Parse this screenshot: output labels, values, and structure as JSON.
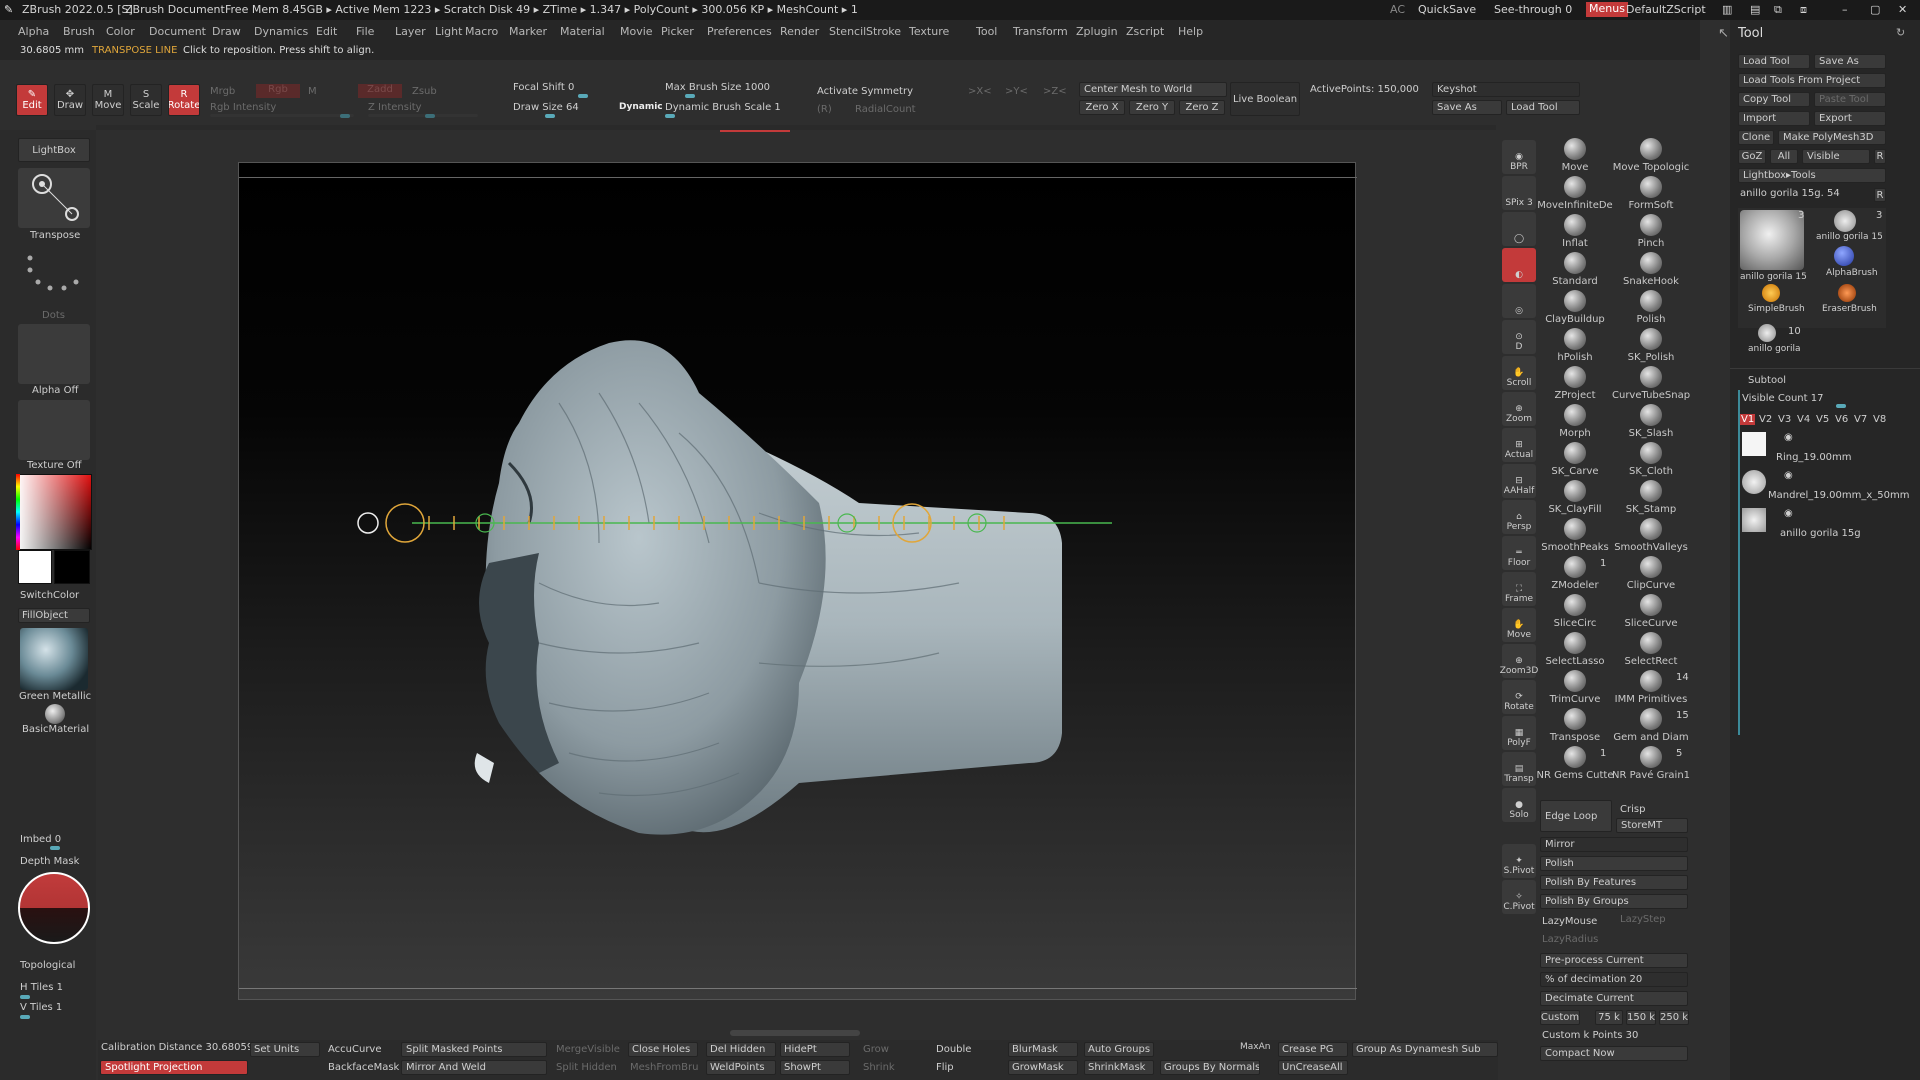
{
  "titlebar": {
    "app": "ZBrush 2022.0.5 [S]",
    "doc": "ZBrush Document",
    "stats": "Free Mem 8.45GB ▸ Active Mem 1223 ▸ Scratch Disk 49 ▸ ZTime ▸ 1.347 ▸ PolyCount ▸ 300.056 KP ▸ MeshCount ▸ 1",
    "ac": "AC",
    "quicksave": "QuickSave",
    "seethrough": "See-through  0",
    "menus": "Menus",
    "script": "DefaultZScript"
  },
  "menu": [
    "Alpha",
    "Brush",
    "Color",
    "Document",
    "Draw",
    "Dynamics",
    "Edit",
    "File",
    "Layer",
    "Light",
    "Macro",
    "Marker",
    "Material",
    "Movie",
    "Picker",
    "Preferences",
    "Render",
    "Stencil",
    "Stroke",
    "Texture",
    "Tool",
    "Transform",
    "Zplugin",
    "Zscript",
    "Help"
  ],
  "infobar": {
    "distance": "30.6805 mm",
    "mode": "TRANSPOSE LINE",
    "hint": "Click to reposition. Press shift to align."
  },
  "shelf": {
    "edit": "Edit",
    "draw": "Draw",
    "move": "Move",
    "scale": "Scale",
    "rotate": "Rotate",
    "mrgb": "Mrgb",
    "rgb": "Rgb",
    "m": "M",
    "zadd": "Zadd",
    "zsub": "Zsub",
    "rgb_intensity": "Rgb Intensity",
    "z_intensity": "Z Intensity",
    "focal_shift": "Focal Shift 0",
    "draw_size": "Draw Size 64",
    "dynamic": "Dynamic",
    "max_brush": "Max Brush Size 1000",
    "dyn_scale": "Dynamic Brush Scale 1",
    "activate_symmetry": "Activate Symmetry",
    "sx": ">X<",
    "sy": ">Y<",
    "sz": ">Z<",
    "r": "(R)",
    "radial": "RadialCount",
    "center_mesh": "Center Mesh to World",
    "zero_x": "Zero X",
    "zero_y": "Zero Y",
    "zero_z": "Zero Z",
    "live_boolean": "Live Boolean",
    "active_points": "ActivePoints: 150,000",
    "keyshot": "Keyshot",
    "save_as": "Save As",
    "load_tool": "Load Tool"
  },
  "left": {
    "lightbox": "LightBox",
    "transpose": "Transpose",
    "dots": "Dots",
    "alpha_off": "Alpha Off",
    "texture_off": "Texture Off",
    "switch_color": "SwitchColor",
    "fill_object": "FillObject",
    "material": "Green Metallic",
    "basic": "BasicMaterial",
    "imbed": "Imbed 0",
    "depth_mask": "Depth Mask",
    "topological": "Topological",
    "htiles": "H Tiles 1",
    "vtiles": "V Tiles 1"
  },
  "nav": [
    "BPR",
    "SPix 3",
    "",
    "",
    "",
    "D",
    "Scroll",
    "Zoom",
    "Actual",
    "AAHalf",
    "Persp",
    "Floor",
    "Frame",
    "Move",
    "Zoom3D",
    "Rotate",
    "PolyF",
    "Transp",
    "Solo",
    "S.Pivot",
    "C.Pivot"
  ],
  "brushes": [
    [
      "Move",
      "Move Topologic"
    ],
    [
      "MoveInfiniteDe",
      "FormSoft"
    ],
    [
      "Inflat",
      "Pinch"
    ],
    [
      "Standard",
      "SnakeHook"
    ],
    [
      "ClayBuildup",
      "Polish"
    ],
    [
      "hPolish",
      "SK_Polish"
    ],
    [
      "ZProject",
      "CurveTubeSnap"
    ],
    [
      "Morph",
      "SK_Slash"
    ],
    [
      "SK_Carve",
      "SK_Cloth"
    ],
    [
      "SK_ClayFill",
      "SK_Stamp"
    ],
    [
      "SmoothPeaks",
      "SmoothValleys"
    ],
    [
      "ZModeler",
      "ClipCurve"
    ],
    [
      "SliceCirc",
      "SliceCurve"
    ],
    [
      "SelectLasso",
      "SelectRect"
    ],
    [
      "TrimCurve",
      "IMM Primitives"
    ],
    [
      "Transpose",
      "Gem and Diam"
    ],
    [
      "NR Gems Cutte",
      "NR Pavé Grain1"
    ]
  ],
  "brush_counts": {
    "imm": "14",
    "gem": "15",
    "nrg": "1",
    "nrp": "5",
    "zm": "1"
  },
  "options": {
    "edge_loop": "Edge Loop",
    "crisp": "Crisp",
    "storemt": "StoreMT",
    "mirror": "Mirror",
    "polish": "Polish",
    "polish_features": "Polish By Features",
    "polish_groups": "Polish By Groups",
    "lazymouse": "LazyMouse",
    "lazystep": "LazyStep",
    "lazyradius": "LazyRadius",
    "preprocess": "Pre-process Current",
    "decimation": "% of decimation 20",
    "decimate": "Decimate Current",
    "custom": "Custom",
    "k75": "75 k",
    "k150": "150 k",
    "k250": "250 k",
    "customk": "Custom k Points 30",
    "compact": "Compact Now"
  },
  "tool": {
    "title": "Tool",
    "load_tool": "Load Tool",
    "save_as": "Save As",
    "load_from_project": "Load Tools From Project",
    "copy_tool": "Copy Tool",
    "paste_tool": "Paste Tool",
    "import": "Import",
    "export": "Export",
    "clone": "Clone",
    "make_polymesh": "Make PolyMesh3D",
    "goz": "GoZ",
    "all": "All",
    "visible": "Visible",
    "r": "R",
    "lightbox_tools": "Lightbox▸Tools",
    "current": "anillo gorila 15g. 54",
    "cur_r": "R",
    "thumbs": [
      "anillo gorila 15",
      "anillo gorila 15",
      "AlphaBrush",
      "SimpleBrush",
      "EraserBrush",
      "anillo gorila"
    ],
    "thumb_counts": [
      "3",
      "3",
      "10"
    ],
    "subtool": "Subtool",
    "visible_count": "Visible Count 17",
    "versions": [
      "V1",
      "V2",
      "V3",
      "V4",
      "V5",
      "V6",
      "V7",
      "V8"
    ],
    "subtools": [
      "Ring_19.00mm",
      "Mandrel_19.00mm_x_50mm",
      "anillo gorila 15g"
    ]
  },
  "bottom": {
    "calibration": "Calibration Distance 30.68059",
    "set_units": "Set Units",
    "spotlight": "Spotlight Projection",
    "accucurve": "AccuCurve",
    "backfacemask": "BackfaceMask",
    "split_masked": "Split Masked Points",
    "mirror_weld": "Mirror And Weld",
    "merge_visible": "MergeVisible",
    "split_hidden": "Split Hidden",
    "close_holes": "Close Holes",
    "meshfrombrush": "MeshFromBru",
    "del_hidden": "Del Hidden",
    "weldpoints": "WeldPoints",
    "hidept": "HidePt",
    "showpt": "ShowPt",
    "grow": "Grow",
    "shrink": "Shrink",
    "double": "Double",
    "flip": "Flip",
    "blurmask": "BlurMask",
    "growmask": "GrowMask",
    "auto_groups": "Auto Groups",
    "shrinkmask": "ShrinkMask",
    "groups_normals": "Groups By Normals",
    "maxan": "MaxAn",
    "crease_pg": "Crease PG",
    "uncrease": "UnCreaseAll",
    "group_dynamesh": "Group As Dynamesh Sub"
  },
  "colors": {
    "accent": "#c33a3a",
    "slider": "#3c8a99",
    "transpose": "#e0a63a",
    "transpose_line": "#49b84f"
  }
}
